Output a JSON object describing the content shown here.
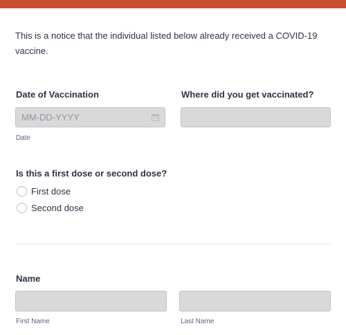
{
  "notice": "This is a notice that the individual listed below already received a COVID-19 vaccine.",
  "vaccination_date": {
    "label": "Date of Vaccination",
    "placeholder": "MM-DD-YYYY",
    "value": "",
    "sublabel": "Date",
    "icon": "calendar-icon"
  },
  "vaccination_place": {
    "label": "Where did you get vaccinated?",
    "value": ""
  },
  "dose": {
    "label": "Is this a first dose or second dose?",
    "options": [
      "First dose",
      "Second dose"
    ],
    "selected": null
  },
  "name": {
    "label": "Name",
    "first": {
      "value": "",
      "sublabel": "First Name"
    },
    "last": {
      "value": "",
      "sublabel": "Last Name"
    }
  },
  "colors": {
    "accent_bar": "#c94f31",
    "field_background": "#d9d9d9"
  }
}
